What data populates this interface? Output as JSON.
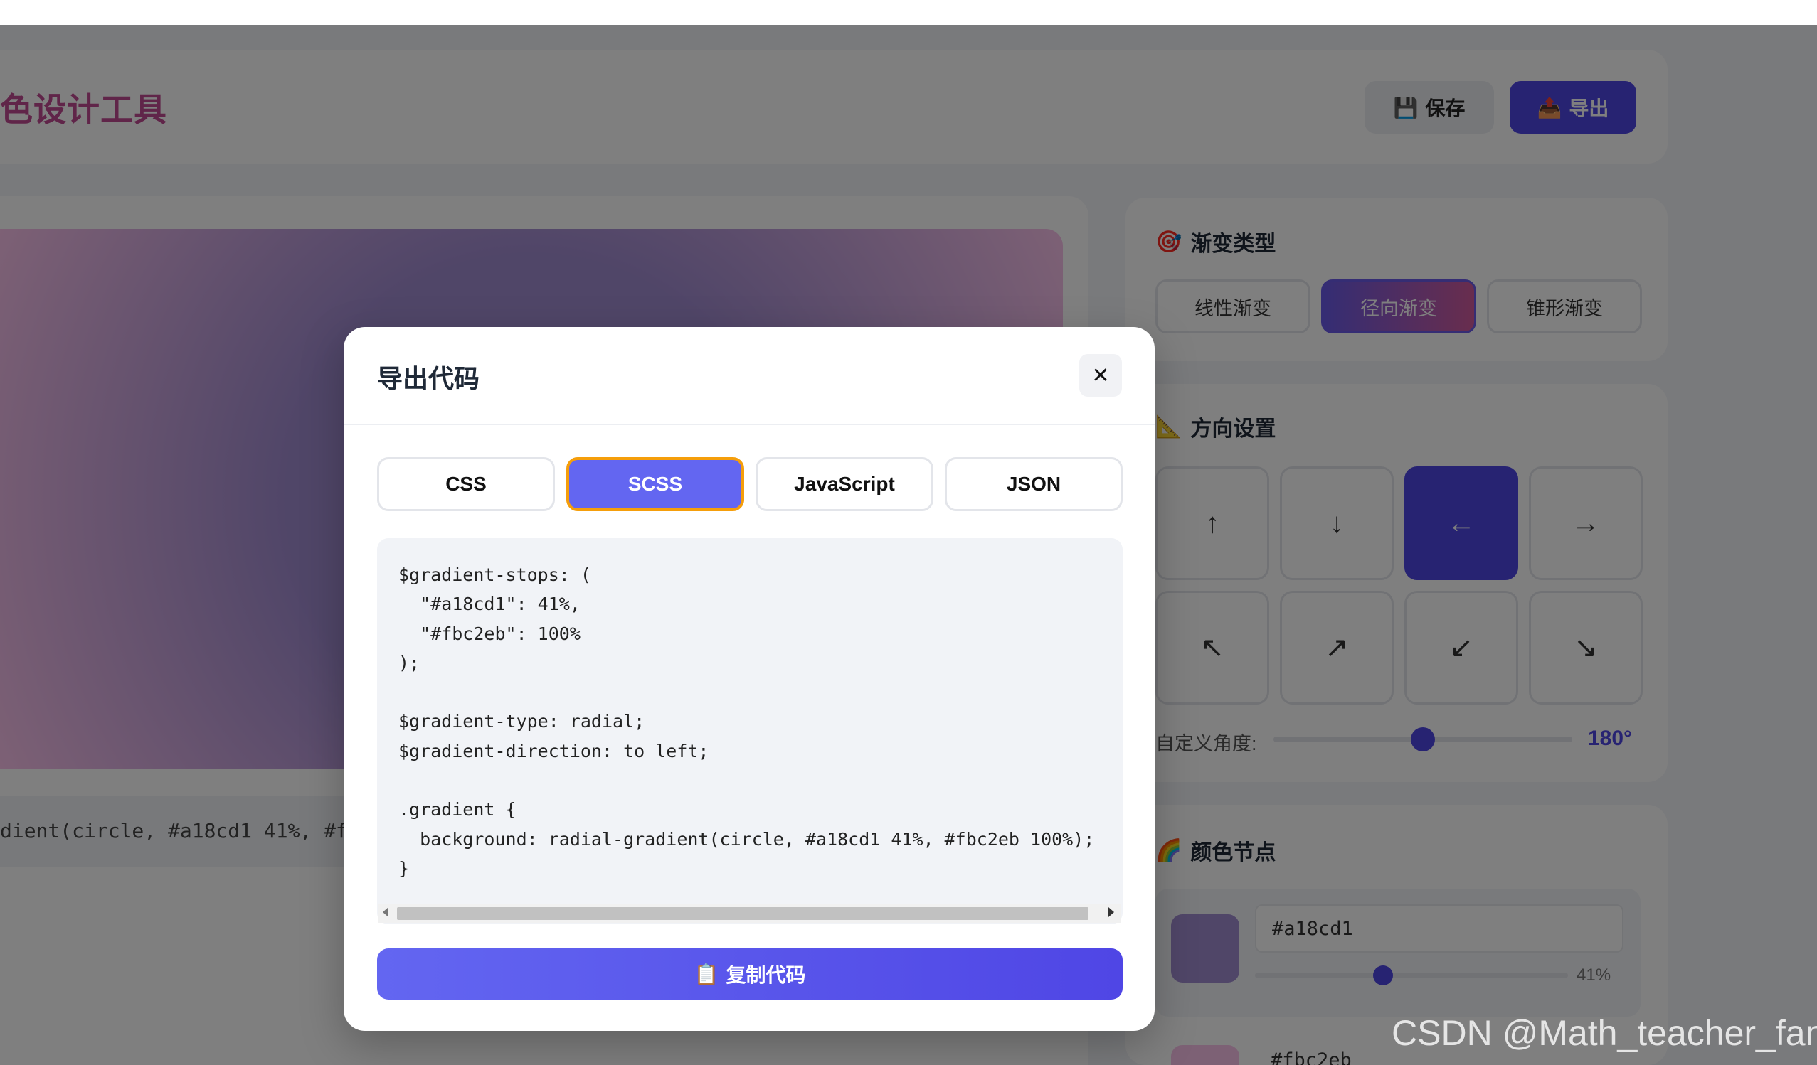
{
  "app": {
    "title": "色设计工具",
    "save_label": "保存",
    "export_label": "导出",
    "css_preview": "dient(circle, #a18cd1 41%, #fb"
  },
  "sidebar": {
    "type_title": "渐变类型",
    "types": [
      "线性渐变",
      "径向渐变",
      "锥形渐变"
    ],
    "active_type": "径向渐变",
    "direction_title": "方向设置",
    "directions": [
      "↑",
      "↓",
      "←",
      "→",
      "↖",
      "↗",
      "↙",
      "↘"
    ],
    "active_direction": "←",
    "angle_label": "自定义角度:",
    "angle_value": "180°",
    "angle_fraction": 0.5,
    "colors_title": "颜色节点",
    "stops": [
      {
        "hex": "#a18cd1",
        "position": "41%",
        "position_value": 41
      },
      {
        "hex": "#fbc2eb"
      }
    ]
  },
  "modal": {
    "title": "导出代码",
    "close": "✕",
    "tabs": [
      "CSS",
      "SCSS",
      "JavaScript",
      "JSON"
    ],
    "active_tab": "SCSS",
    "code": "$gradient-stops: (\n  \"#a18cd1\": 41%,\n  \"#fbc2eb\": 100%\n);\n\n$gradient-type: radial;\n$gradient-direction: to left;\n\n.gradient {\n  background: radial-gradient(circle, #a18cd1 41%, #fbc2eb 100%);\n}",
    "copy_label": "复制代码"
  },
  "watermark": "CSDN @Math_teacher_fan",
  "colors": {
    "accent": "#4f46e5",
    "tab_active": "#6366f1",
    "tab_active_border": "#f59e0b",
    "stop1": "#a18cd1",
    "stop2": "#fbc2eb"
  }
}
